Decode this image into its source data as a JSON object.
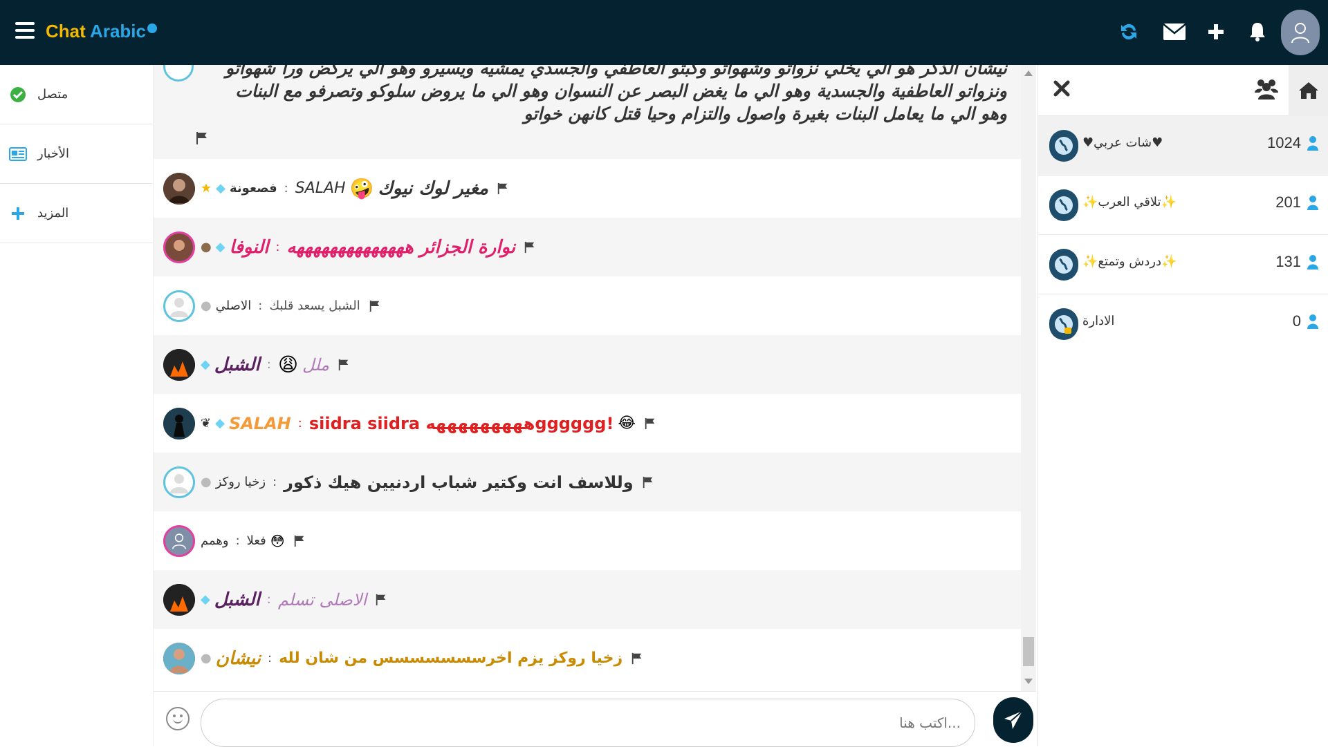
{
  "topbar": {
    "logo_part1": "Chat",
    "logo_part2": "Arabic",
    "icons": [
      "menu-icon",
      "refresh-icon",
      "mail-icon",
      "plus-icon",
      "bell-icon",
      "user-avatar-icon"
    ],
    "bg_color": "#04222f",
    "accent_color": "#2aa7e6"
  },
  "sidebar": {
    "items": [
      {
        "label": "متصل",
        "icon": "online-status-icon"
      },
      {
        "label": "الأخبار",
        "icon": "news-icon"
      },
      {
        "label": "المزيد",
        "icon": "plus-icon"
      }
    ]
  },
  "chat": {
    "top_message": "نيشان الذكر هو الي يخلي نزواتو وشهواتو وكبتو العاطفي والجسدي يمشيه ويسيرو وهو الي يركض ورا شهواتو ونزواتو العاطفية والجسدية وهو الي ما يغض البصر عن النسوان وهو الي ما يروض سلوكو وتصرفو مع البنات وهو الي ما يعامل البنات بغيرة واصول والتزام وحيا قتل كانهن خواتو",
    "messages": [
      {
        "user": "فصعونة",
        "text": "مغير لوك نيوك",
        "extra": "SALAH",
        "user_color": "#333333",
        "text_color": "#333333"
      },
      {
        "user": "النوفا",
        "text": "نوارة الجزائر ههههههههههههههه",
        "user_color": "#e0206b",
        "text_color": "#e0206b"
      },
      {
        "user": "الاصلي",
        "text": "الشبل يسعد قلبك",
        "user_color": "#333333",
        "text_color": "#555555"
      },
      {
        "user": "الشبل",
        "text": "ملل",
        "user_color": "#5a2060",
        "text_color": "#b07ab8"
      },
      {
        "user": "SALAH",
        "text": "siidra siidra ههههههههههgggggg!",
        "user_color": "#f39a3a",
        "text_color": "#e02020"
      },
      {
        "user": "زخيا روكز",
        "text": "وللاسف انت وكتير شباب اردنيين هيك ذكور",
        "user_color": "#333333",
        "text_color": "#333333"
      },
      {
        "user": "وهمم",
        "text": "فعلا",
        "user_color": "#333333",
        "text_color": "#333333"
      },
      {
        "user": "الشبل",
        "text": "الاصلى تسلم",
        "user_color": "#5a2060",
        "text_color": "#b07ab8"
      },
      {
        "user": "نيشان",
        "text": "زخيا روكز يزم اخرسسسسسسس من شان لله",
        "user_color": "#c98a00",
        "text_color": "#c98a00"
      }
    ]
  },
  "input": {
    "placeholder": "...اكتب هنا"
  },
  "rooms": {
    "items": [
      {
        "name": "♥شات عربي♥",
        "count": "1024"
      },
      {
        "name": "✨تلاقي العرب✨",
        "count": "201"
      },
      {
        "name": "✨دردش وتمتع✨",
        "count": "131"
      },
      {
        "name": "الادارة",
        "count": "0"
      }
    ]
  }
}
